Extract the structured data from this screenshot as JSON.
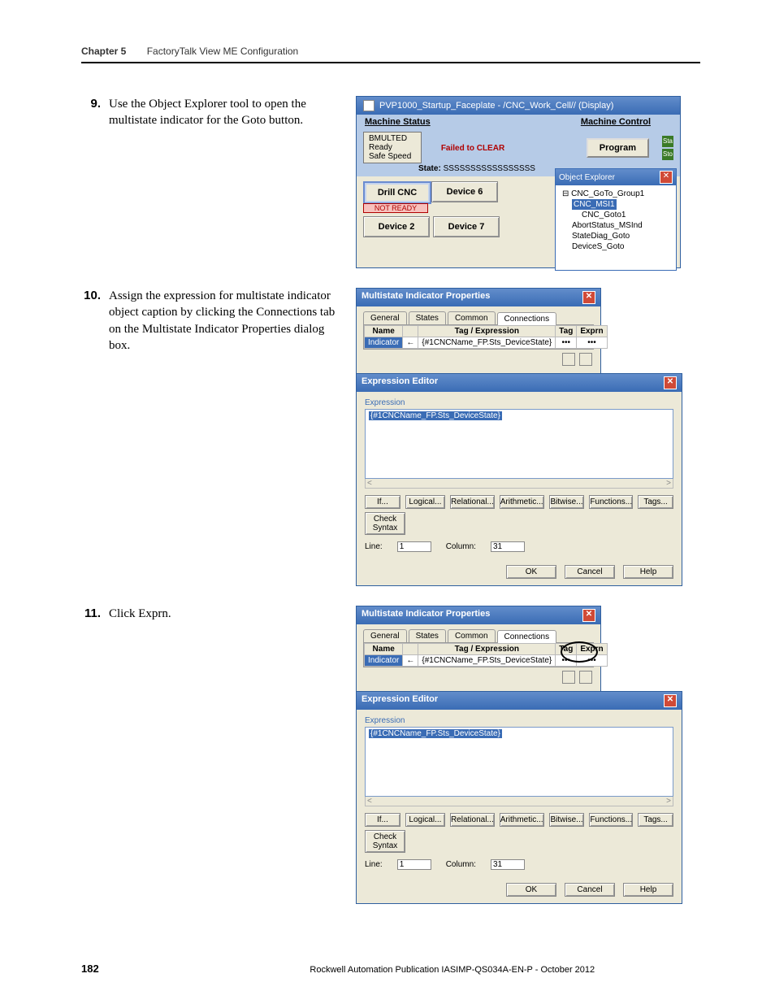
{
  "header": {
    "chapter_label": "Chapter 5",
    "chapter_title": "FactoryTalk View ME Configuration"
  },
  "steps": {
    "s9": {
      "num": "9.",
      "text": "Use the Object Explorer tool to open the multistate indicator for the Goto button."
    },
    "s10": {
      "num": "10.",
      "text": "Assign the expression for multistate indicator object caption by clicking the Connections tab on the Multistate Indicator Properties dialog box."
    },
    "s11": {
      "num": "11.",
      "text": "Click Exprn."
    }
  },
  "ss1": {
    "title": "PVP1000_Startup_Faceplate - /CNC_Work_Cell// (Display)",
    "hdr_left": "Machine Status",
    "hdr_right": "Machine Control",
    "status": {
      "l1": "BMULTED",
      "l2": "Ready",
      "l3": "Safe Speed"
    },
    "fail": "Failed to CLEAR",
    "state_lbl": "State:",
    "state_val": "SSSSSSSSSSSSSSSSS",
    "program": "Program",
    "right_tag1": "Sta",
    "right_tag2": "Sto",
    "devices": {
      "drill": "Drill CNC",
      "drill_cap": "NOT READY",
      "d6": "Device 6",
      "d2": "Device 2",
      "d7": "Device 7"
    },
    "oe": {
      "title": "Object Explorer",
      "n1": "⊟ CNC_GoTo_Group1",
      "n1b": "CNC_MSI1",
      "n2": "CNC_Goto1",
      "n3": "AbortStatus_MSInd",
      "n4": "StateDiag_Goto",
      "n5": "DeviceS_Goto"
    }
  },
  "msi": {
    "title": "Multistate Indicator Properties",
    "tabs": {
      "t1": "General",
      "t2": "States",
      "t3": "Common",
      "t4": "Connections"
    },
    "cols": {
      "c1": "Name",
      "c2": "Tag / Expression",
      "c3": "Tag",
      "c4": "Exprn"
    },
    "row": {
      "name": "Indicator",
      "arrow": "←",
      "expr": "{#1CNCName_FP.Sts_DeviceState}",
      "tag": "•••",
      "exprn": "•••"
    }
  },
  "ee": {
    "title": "Expression Editor",
    "lbl": "Expression",
    "expr": "{#1CNCName_FP.Sts_DeviceState}",
    "btns": {
      "b1": "If...",
      "b2": "Logical...",
      "b3": "Relational...",
      "b4": "Arithmetic...",
      "b5": "Bitwise...",
      "b6": "Functions...",
      "b7": "Tags..."
    },
    "check": "Check Syntax",
    "line_lbl": "Line:",
    "line_val": "1",
    "col_lbl": "Column:",
    "col_val": "31",
    "ok": "OK",
    "cancel": "Cancel",
    "help": "Help"
  },
  "footer": {
    "page": "182",
    "pub": "Rockwell Automation Publication IASIMP-QS034A-EN-P - ",
    "date": "October 2012"
  }
}
